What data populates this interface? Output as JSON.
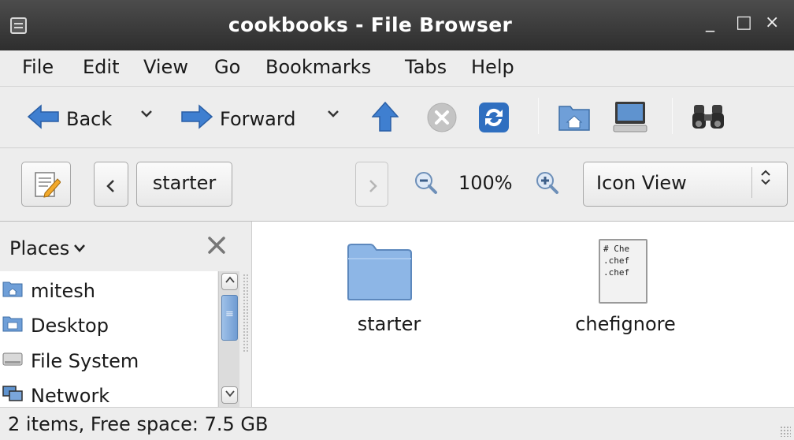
{
  "window": {
    "title": "cookbooks - File Browser",
    "icon": "window-menu-icon",
    "controls": {
      "minimize": "_",
      "maximize": "□",
      "close": "×"
    }
  },
  "menubar": {
    "items": [
      "File",
      "Edit",
      "View",
      "Go",
      "Bookmarks",
      "Tabs",
      "Help"
    ]
  },
  "toolbar": {
    "back_label": "Back",
    "forward_label": "Forward",
    "icons": [
      "back-arrow-icon",
      "forward-arrow-icon",
      "up-arrow-icon",
      "stop-icon",
      "reload-icon",
      "home-folder-icon",
      "computer-icon",
      "search-binoculars-icon"
    ],
    "colors": {
      "arrow_blue": "#3f7fd0",
      "stop_gray": "#b8b8b8",
      "reload_blue": "#2f6fc0"
    }
  },
  "location": {
    "breadcrumb": "starter",
    "zoom_level": "100%",
    "view_mode": "Icon View"
  },
  "sidebar": {
    "header": "Places",
    "items": [
      {
        "label": "mitesh",
        "icon": "home-folder-icon"
      },
      {
        "label": "Desktop",
        "icon": "desktop-folder-icon"
      },
      {
        "label": "File System",
        "icon": "drive-icon"
      },
      {
        "label": "Network",
        "icon": "network-icon"
      }
    ]
  },
  "files": [
    {
      "name": "starter",
      "type": "folder",
      "icon": "folder-icon"
    },
    {
      "name": "chefignore",
      "type": "text",
      "icon": "text-file-icon",
      "preview_lines": [
        "# Che",
        ".chef",
        ".chef"
      ]
    }
  ],
  "statusbar": {
    "text": "2 items, Free space: 7.5 GB"
  }
}
